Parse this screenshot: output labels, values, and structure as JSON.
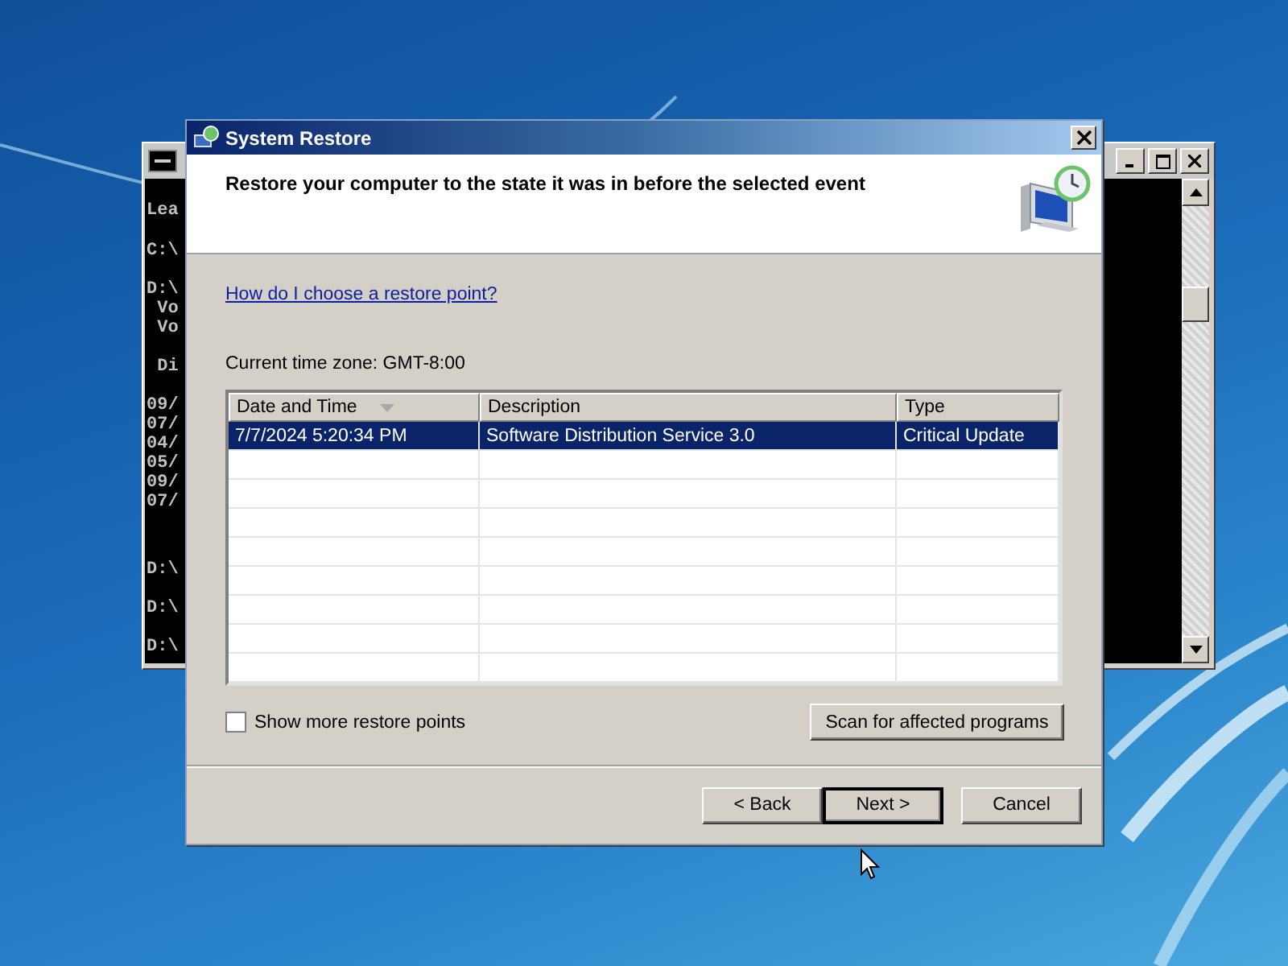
{
  "console_window": {
    "blocks": [
      [
        "Lea"
      ],
      [
        "C:\\"
      ],
      [
        "D:\\",
        " Vo",
        " Vo"
      ],
      [
        " Di"
      ],
      [
        "09/",
        "07/",
        "04/",
        "05/",
        "09/",
        "07/"
      ]
    ],
    "prompts": [
      "D:\\",
      "D:\\",
      "D:\\"
    ]
  },
  "window": {
    "title": "System Restore"
  },
  "header": {
    "heading": "Restore your computer to the state it was in before the selected event"
  },
  "help_link": "How do I choose a restore point?",
  "time_zone": "Current time zone: GMT-8:00",
  "table": {
    "columns": [
      {
        "label": "Date and Time",
        "sorted": true
      },
      {
        "label": "Description",
        "sorted": false
      },
      {
        "label": "Type",
        "sorted": false
      }
    ],
    "rows": [
      {
        "cells": [
          "7/7/2024 5:20:34 PM",
          "Software Distribution Service 3.0",
          "Critical Update"
        ],
        "selected": true
      }
    ]
  },
  "show_more": {
    "label": "Show more restore points",
    "checked": false
  },
  "scan_button": "Scan for affected programs",
  "buttons": [
    {
      "label": "< Back",
      "default": false
    },
    {
      "label": "Next >",
      "default": true
    },
    {
      "label": "Cancel",
      "default": false
    }
  ]
}
